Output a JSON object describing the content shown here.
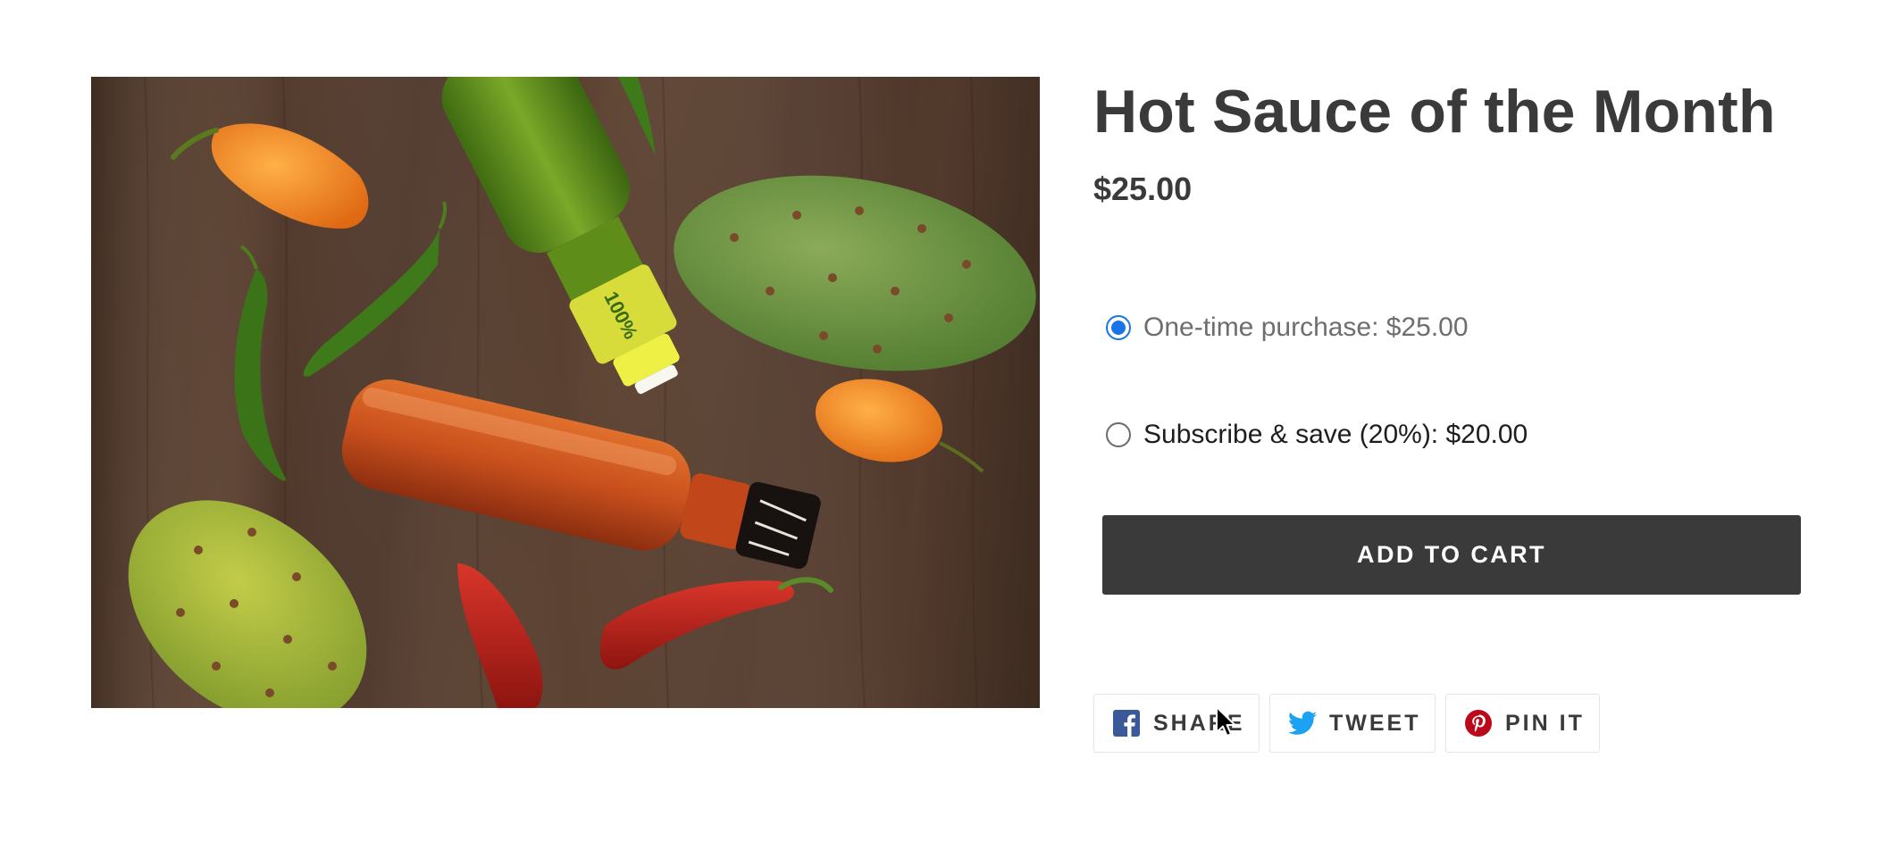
{
  "product": {
    "image_alt": "Hot sauce bottles, peppers and prickly pears on a wooden board",
    "title": "Hot Sauce of the Month",
    "price": "$25.00"
  },
  "purchase_options": [
    {
      "label": "One-time purchase: $25.00",
      "selected": true
    },
    {
      "label": "Subscribe & save (20%): $20.00",
      "selected": false
    }
  ],
  "cart": {
    "button_label": "ADD TO CART"
  },
  "share": {
    "facebook": {
      "label": "SHARE",
      "icon": "facebook-icon",
      "color": "#3b5998"
    },
    "twitter": {
      "label": "TWEET",
      "icon": "twitter-icon",
      "color": "#1da1f2"
    },
    "pinterest": {
      "label": "PIN IT",
      "icon": "pinterest-icon",
      "color": "#bd081c"
    }
  },
  "colors": {
    "accent_blue": "#1a73e8",
    "button_dark": "#3a3a3a",
    "text_dark": "#3a3a3a",
    "border": "#e4e4e4"
  }
}
